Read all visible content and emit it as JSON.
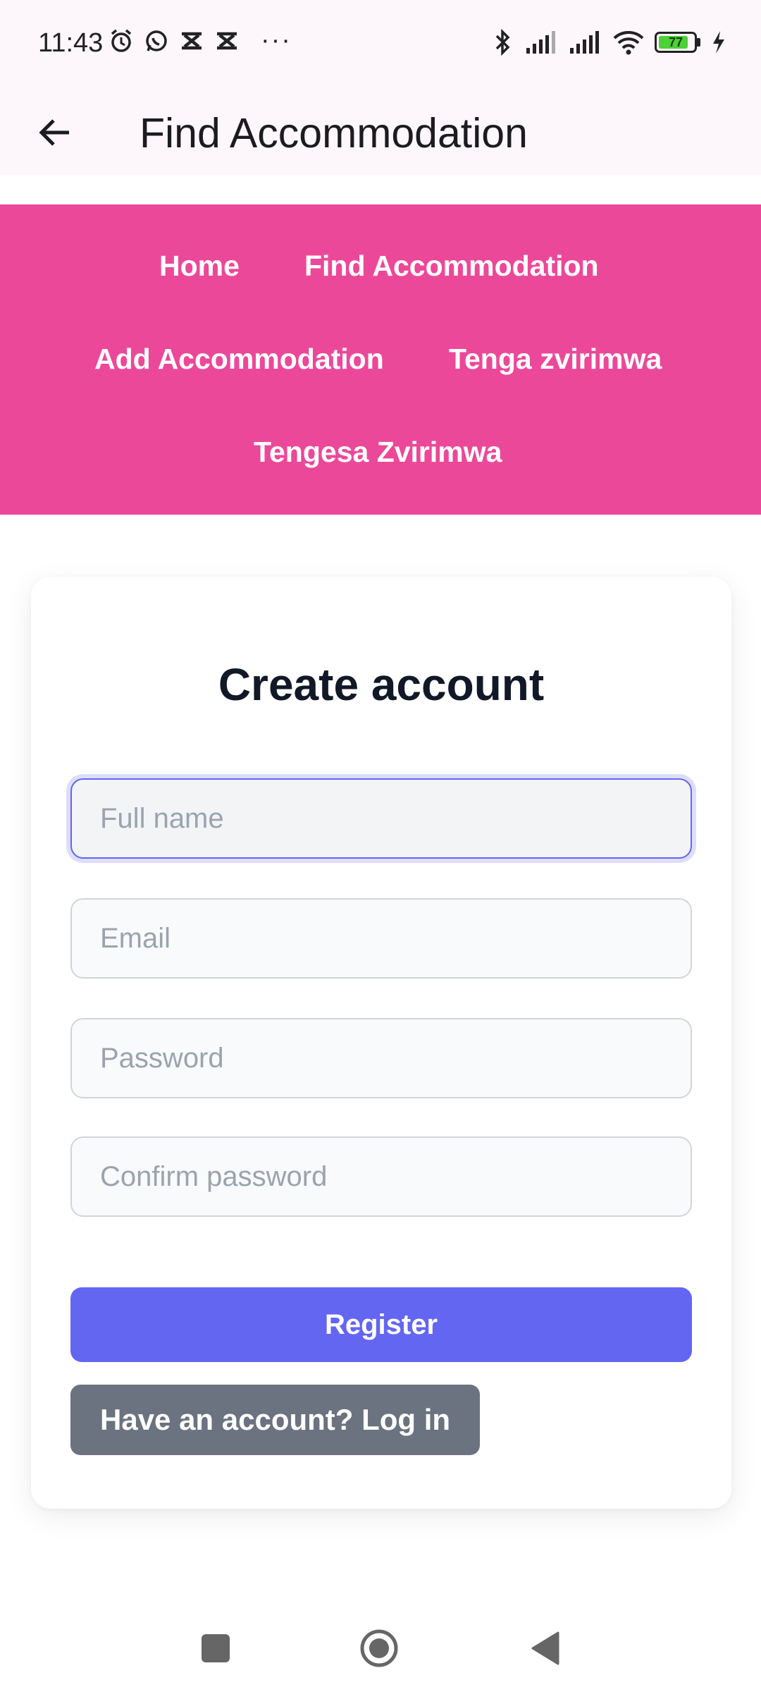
{
  "status_bar": {
    "time": "11:43",
    "more": "···",
    "battery_level": "77",
    "icons": [
      "alarm-icon",
      "whatsapp-icon",
      "app-icon",
      "app-icon",
      "bluetooth-icon",
      "signal-icon",
      "signal-icon",
      "wifi-icon",
      "battery-icon",
      "charging-icon"
    ]
  },
  "app_bar": {
    "title": "Find Accommodation",
    "back_icon": "arrow-left-icon"
  },
  "nav": {
    "items": [
      {
        "label": "Home"
      },
      {
        "label": "Find Accommodation"
      },
      {
        "label": "Add Accommodation"
      },
      {
        "label": "Tenga zvirimwa"
      },
      {
        "label": "Tengesa Zvirimwa"
      }
    ]
  },
  "form": {
    "title": "Create account",
    "fields": {
      "full_name": {
        "placeholder": "Full name",
        "value": ""
      },
      "email": {
        "placeholder": "Email",
        "value": ""
      },
      "password": {
        "placeholder": "Password",
        "value": ""
      },
      "confirm_password": {
        "placeholder": "Confirm password",
        "value": ""
      }
    },
    "register_label": "Register",
    "login_label": "Have an account? Log in"
  },
  "colors": {
    "nav_bg": "#ec4899",
    "primary": "#6366f1",
    "secondary_button": "#6b7280",
    "app_bar_bg": "#fdf7fc"
  }
}
